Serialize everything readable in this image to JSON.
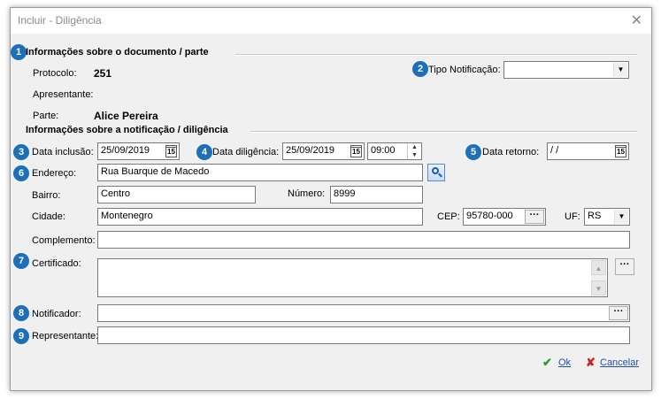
{
  "window": {
    "title": "Incluir - Diligência",
    "close_glyph": "✕"
  },
  "sections": {
    "documento": "Informações sobre o documento / parte",
    "notificacao": "Informações sobre a notificação / diligência"
  },
  "badges": [
    "1",
    "2",
    "3",
    "4",
    "5",
    "6",
    "7",
    "8",
    "9"
  ],
  "documento": {
    "protocolo_label": "Protocolo:",
    "protocolo_value": "251",
    "apresentante_label": "Apresentante:",
    "parte_label": "Parte:",
    "parte_value": "Alice Pereira",
    "tipo_label": "Tipo Notificação:",
    "tipo_value": ""
  },
  "form": {
    "data_inclusao_label": "Data inclusão:",
    "data_inclusao": "25/09/2019",
    "data_diligencia_label": "Data diligência:",
    "data_diligencia": "25/09/2019",
    "hora_diligencia": "09:00",
    "data_retorno_label": "Data retorno:",
    "data_retorno": " /  /",
    "endereco_label": "Endereço:",
    "endereco": "Rua Buarque de Macedo",
    "bairro_label": "Bairro:",
    "bairro": "Centro",
    "numero_label": "Número:",
    "numero": "8999",
    "cidade_label": "Cidade:",
    "cidade": "Montenegro",
    "cep_label": "CEP:",
    "cep": "95780-000",
    "uf_label": "UF:",
    "uf": "RS",
    "complemento_label": "Complemento:",
    "complemento": "",
    "certificado_label": "Certificado:",
    "certificado": "",
    "notificador_label": "Notificador:",
    "notificador": "",
    "representante_label": "Representante:",
    "representante": ""
  },
  "icons": {
    "calendar": "15",
    "dots": "···",
    "dropdown": "▼",
    "up": "▲",
    "down": "▼",
    "ok": "✔",
    "cancel": "✘"
  },
  "colors": {
    "badge": "#1d6fb8",
    "ok": "#2e9b2e",
    "cancel": "#cc2222",
    "link": "#1d50b0"
  },
  "actions": {
    "ok": "Ok",
    "cancelar": "Cancelar"
  }
}
